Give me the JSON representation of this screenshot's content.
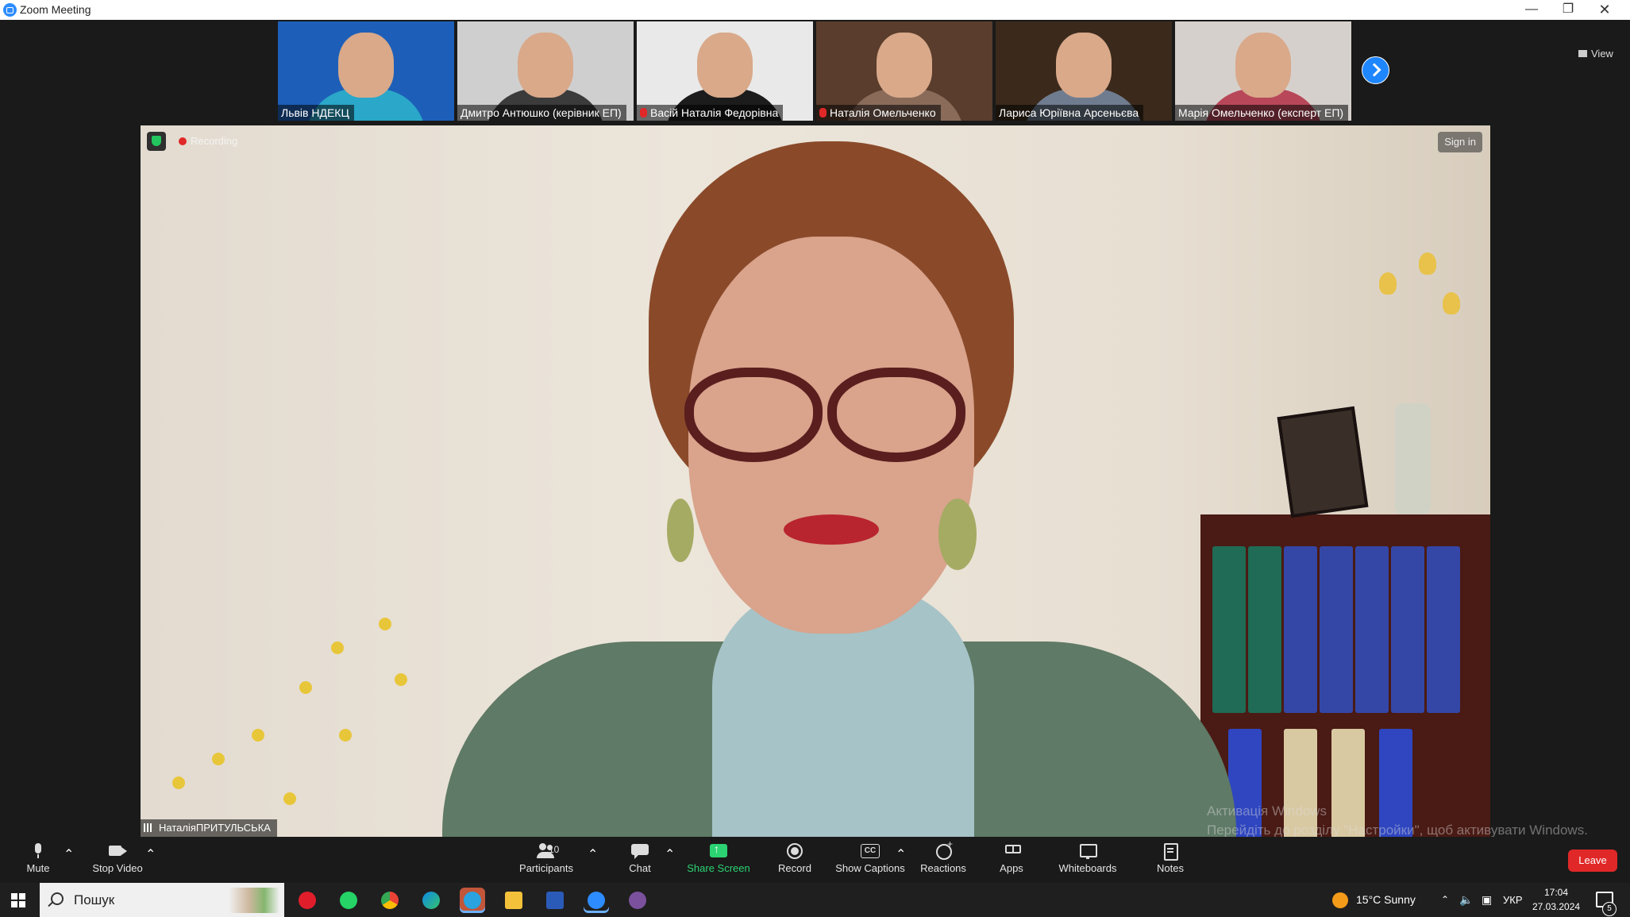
{
  "window": {
    "title": "Zoom Meeting"
  },
  "gallery": {
    "tiles": [
      {
        "name": "Львів НДЕКЦ",
        "muted": false,
        "bg": "#1d5fb8",
        "shirt": "#2aa7c9"
      },
      {
        "name": "Дмитро Антюшко (керівник ЕП)",
        "muted": false,
        "bg": "#cfcfcf",
        "shirt": "#3b3b3b"
      },
      {
        "name": "Васій Наталія Федорівна",
        "muted": true,
        "bg": "#e9e9e9",
        "shirt": "#1c1c1c"
      },
      {
        "name": "Наталія Омельченко",
        "muted": true,
        "bg": "#5a3d2c",
        "shirt": "#8a6b5a"
      },
      {
        "name": "Лариса Юріївна Арсеньєва",
        "muted": false,
        "bg": "#3b2a1c",
        "shirt": "#6f7c8f"
      },
      {
        "name": "Марія Омельченко (експерт ЕП)",
        "muted": false,
        "bg": "#d6d0cc",
        "shirt": "#b8475a"
      }
    ],
    "view_label": "View"
  },
  "main_video": {
    "recording_label": "Recording",
    "signin_label": "Sign in",
    "speaker_name": "НаталіяПРИТУЛЬСЬКА"
  },
  "watermark": {
    "line1": "Активація Windows",
    "line2": "Перейдіть до розділу \"Настройки\", щоб активувати Windows."
  },
  "toolbar": {
    "mute": "Mute",
    "stop_video": "Stop Video",
    "participants": "Participants",
    "participants_count": "10",
    "chat": "Chat",
    "share_screen": "Share Screen",
    "record": "Record",
    "show_captions": "Show Captions",
    "reactions": "Reactions",
    "apps": "Apps",
    "whiteboards": "Whiteboards",
    "notes": "Notes",
    "leave": "Leave"
  },
  "taskbar": {
    "search_placeholder": "Пошук",
    "weather": "15°C  Sunny",
    "language": "УКР",
    "time": "17:04",
    "date": "27.03.2024",
    "notification_count": "5"
  },
  "colors": {
    "accent_blue": "#1e86ff",
    "share_green": "#2bd372",
    "leave_red": "#e02828"
  }
}
